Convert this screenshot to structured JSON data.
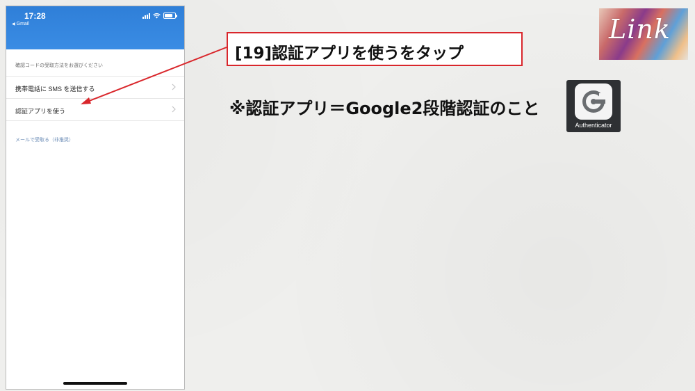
{
  "status_bar": {
    "time": "17:28",
    "back_app": "Gmail"
  },
  "phone": {
    "section_label": "確認コードの受取方法をお選びください",
    "options": [
      {
        "label": "携帯電話に SMS を送信する"
      },
      {
        "label": "認証アプリを使う"
      }
    ],
    "email_link": "メールで受取る（非推奨）"
  },
  "callout": {
    "text": "[19]認証アプリを使うをタップ"
  },
  "note": {
    "text": "※認証アプリ＝Google2段階認証のこと"
  },
  "authenticator_icon": {
    "label": "Authenticator"
  },
  "logo": {
    "text": "Link"
  },
  "colors": {
    "header_blue": "#3a8ce4",
    "callout_red": "#d9262b",
    "link_blue": "#6f8fb8"
  }
}
